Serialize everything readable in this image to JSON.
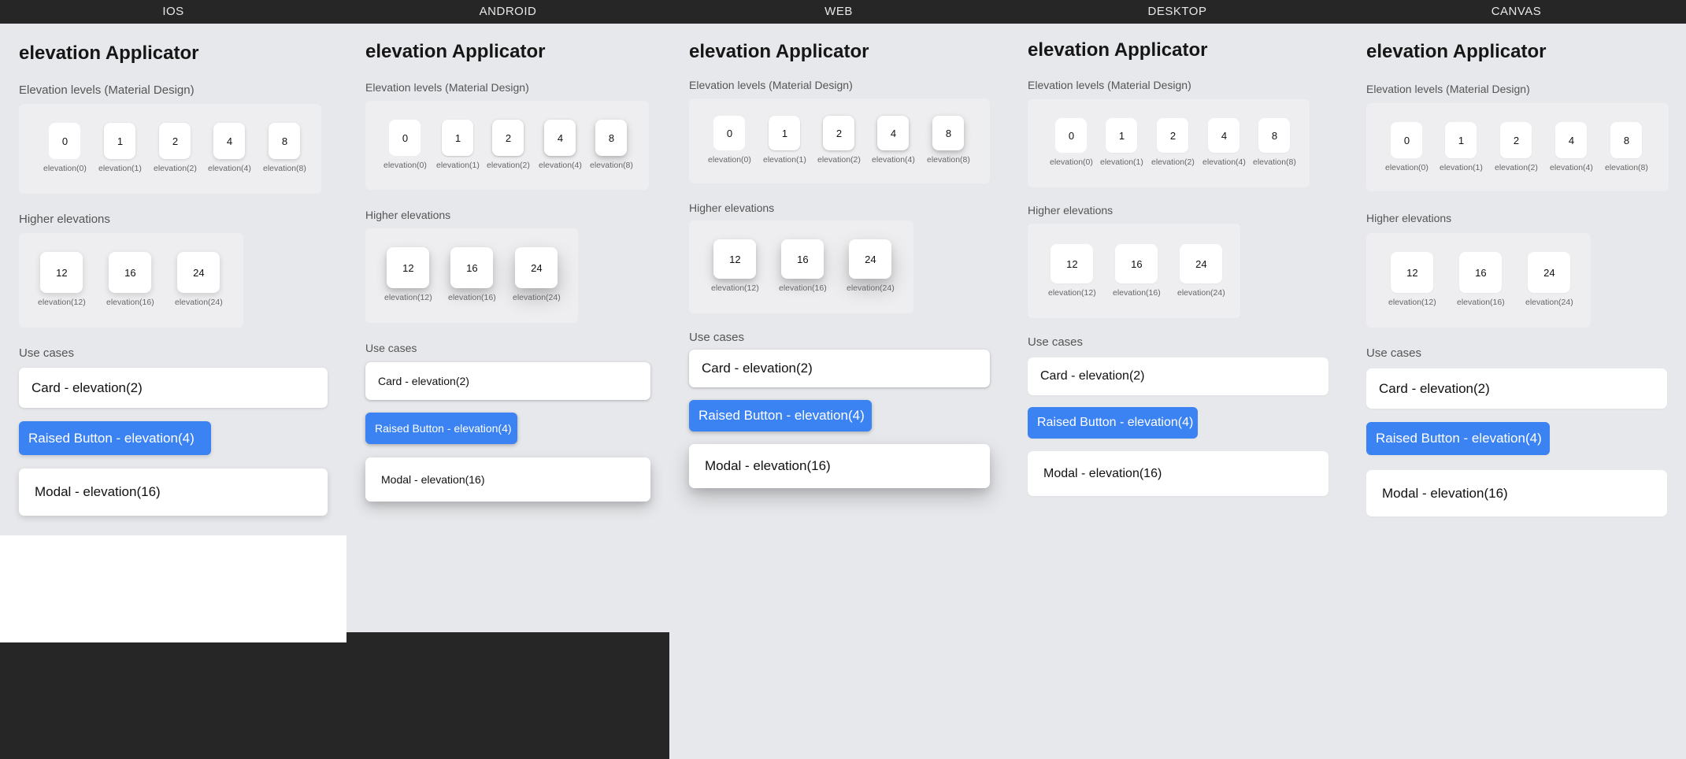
{
  "columns": [
    {
      "name": "IOS"
    },
    {
      "name": "ANDROID"
    },
    {
      "name": "WEB"
    },
    {
      "name": "DESKTOP"
    },
    {
      "name": "CANVAS"
    }
  ],
  "content": {
    "title": "elevation Applicator",
    "levels_label": "Elevation levels (Material Design)",
    "levels": [
      {
        "value": "0",
        "caption": "elevation(0)"
      },
      {
        "value": "1",
        "caption": "elevation(1)"
      },
      {
        "value": "2",
        "caption": "elevation(2)"
      },
      {
        "value": "4",
        "caption": "elevation(4)"
      },
      {
        "value": "8",
        "caption": "elevation(8)"
      }
    ],
    "higher_label": "Higher elevations",
    "higher": [
      {
        "value": "12",
        "caption": "elevation(12)"
      },
      {
        "value": "16",
        "caption": "elevation(16)"
      },
      {
        "value": "24",
        "caption": "elevation(24)"
      }
    ],
    "use_cases_label": "Use cases",
    "card_label": "Card - elevation(2)",
    "raised_button_label": "Raised Button - elevation(4)",
    "modal_label": "Modal - elevation(16)"
  },
  "colors": {
    "frame_bg": "#262626",
    "panel_bg": "#e7e8eb",
    "accent_blue": "#3b82f2",
    "card_bg": "#ffffff"
  }
}
